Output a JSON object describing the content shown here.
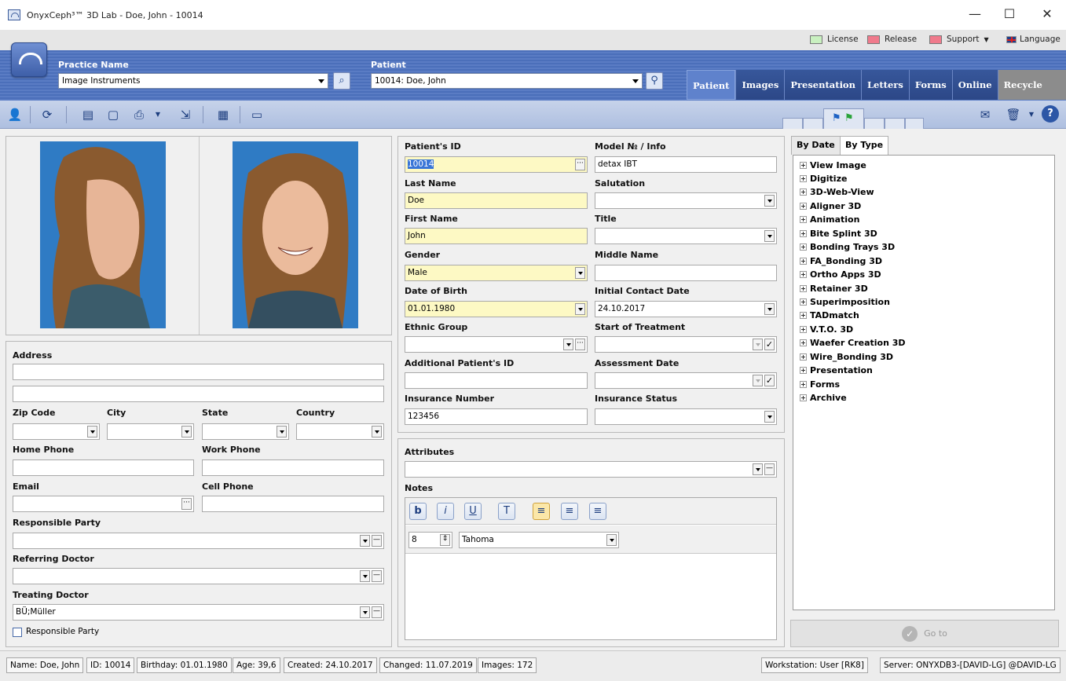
{
  "window": {
    "title": "OnyxCeph³™ 3D Lab - Doe, John - 10014",
    "minimize": "—",
    "maximize": "☐",
    "close": "✕"
  },
  "top_links": {
    "license": "License",
    "release": "Release",
    "support": "Support",
    "support_caret": "▼",
    "language": "Language",
    "colors": {
      "license": "#c9f0c0",
      "release": "#f07a8c",
      "support": "#f07a8c"
    }
  },
  "header": {
    "practice_label": "Practice Name",
    "practice_value": "Image Instruments",
    "patient_label": "Patient",
    "patient_value": "10014: Doe, John",
    "tabs": [
      "Patient",
      "Images",
      "Presentation",
      "Letters",
      "Forms",
      "Online",
      "Recycle Bin"
    ]
  },
  "toolbar": {
    "icons": [
      "patient-add-icon",
      "refresh-icon",
      "database-icon",
      "document-icon",
      "print-icon",
      "export-icon",
      "qr-icon",
      "save-icon",
      "message-icon",
      "trash-icon",
      "help-icon"
    ]
  },
  "address": {
    "section_label": "Address",
    "zip_label": "Zip Code",
    "city_label": "City",
    "state_label": "State",
    "country_label": "Country",
    "home_phone_label": "Home Phone",
    "work_phone_label": "Work Phone",
    "email_label": "Email",
    "cell_phone_label": "Cell Phone",
    "responsible_party_label": "Responsible Party",
    "referring_doctor_label": "Referring Doctor",
    "treating_doctor_label": "Treating Doctor",
    "treating_doctor_value": "BÜ;Müller",
    "responsible_party_checkbox": "Responsible Party"
  },
  "patient_form": {
    "patient_id_label": "Patient's ID",
    "patient_id_value": "10014",
    "model_label": "Model № / Info",
    "model_value": "detax IBT",
    "last_name_label": "Last Name",
    "last_name_value": "Doe",
    "salutation_label": "Salutation",
    "first_name_label": "First Name",
    "first_name_value": "John",
    "title_label": "Title",
    "gender_label": "Gender",
    "gender_value": "Male",
    "middle_name_label": "Middle Name",
    "dob_label": "Date of Birth",
    "dob_value": "01.01.1980",
    "initial_contact_label": "Initial Contact Date",
    "initial_contact_value": "24.10.2017",
    "ethnic_label": "Ethnic Group",
    "start_treatment_label": "Start of Treatment",
    "additional_id_label": "Additional Patient's ID",
    "assessment_label": "Assessment Date",
    "insurance_number_label": "Insurance Number",
    "insurance_number_value": "123456",
    "insurance_status_label": "Insurance Status"
  },
  "notes": {
    "attributes_label": "Attributes",
    "notes_label": "Notes",
    "font_size": "8",
    "font_name": "Tahoma",
    "bold": "b",
    "italic": "i",
    "underline": "U"
  },
  "right_panel": {
    "tab_by_date": "By Date",
    "tab_by_type": "By Type",
    "tree": [
      "View Image",
      "Digitize",
      "3D-Web-View",
      "Aligner 3D",
      "Animation",
      "Bite Splint 3D",
      "Bonding Trays 3D",
      "FA_Bonding 3D",
      "Ortho Apps 3D",
      "Retainer 3D",
      "Superimposition",
      "TADmatch",
      "V.T.O. 3D",
      "Waefer Creation 3D",
      "Wire_Bonding 3D",
      "Presentation",
      "Forms",
      "Archive"
    ],
    "goto_label": "Go to"
  },
  "statusbar": {
    "name": "Name: Doe, John",
    "id": "ID: 10014",
    "birthday": "Birthday: 01.01.1980",
    "age": "Age: 39,6",
    "created": "Created: 24.10.2017",
    "changed": "Changed: 11.07.2019",
    "images": "Images: 172",
    "workstation": "Workstation: User [RK8]",
    "server": "Server: ONYXDB3-[DAVID-LG] @DAVID-LG"
  }
}
